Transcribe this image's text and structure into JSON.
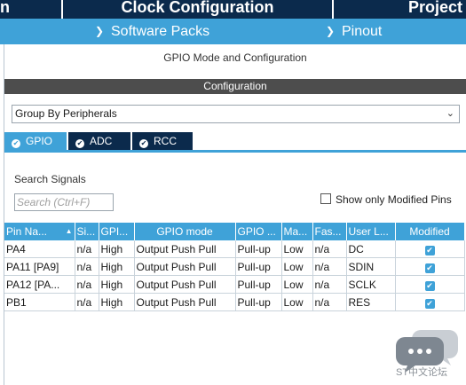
{
  "top_tabs": [
    "n",
    "Clock Configuration",
    "Project"
  ],
  "sub_menu": [
    "Software Packs",
    "Pinout"
  ],
  "section_title": "GPIO Mode and Configuration",
  "config_header": "Configuration",
  "group_select": {
    "value": "Group By Peripherals"
  },
  "peripheral_tabs": [
    {
      "label": "GPIO",
      "active": true
    },
    {
      "label": "ADC",
      "active": false
    },
    {
      "label": "RCC",
      "active": false
    }
  ],
  "search": {
    "label": "Search Signals",
    "placeholder": "Search (Ctrl+F)"
  },
  "show_modified": {
    "label": "Show only Modified Pins",
    "checked": false
  },
  "table": {
    "columns": [
      "Pin Na...",
      "Si...",
      "GPI...",
      "GPIO mode",
      "GPIO ...",
      "Ma...",
      "Fas...",
      "User L...",
      "Modified"
    ],
    "rows": [
      [
        "PA4",
        "n/a",
        "High",
        "Output Push Pull",
        "Pull-up",
        "Low",
        "n/a",
        "DC",
        "✔"
      ],
      [
        "PA11 [PA9]",
        "n/a",
        "High",
        "Output Push Pull",
        "Pull-up",
        "Low",
        "n/a",
        "SDIN",
        "✔"
      ],
      [
        "PA12 [PA...",
        "n/a",
        "High",
        "Output Push Pull",
        "Pull-up",
        "Low",
        "n/a",
        "SCLK",
        "✔"
      ],
      [
        "PB1",
        "n/a",
        "High",
        "Output Push Pull",
        "Pull-up",
        "Low",
        "n/a",
        "RES",
        "✔"
      ]
    ]
  },
  "watermark": {
    "text": "ST中文论坛",
    "icon": "chat-bubbles-icon"
  },
  "colors": {
    "navy": "#0b2a4c",
    "accent": "#3fa2d8",
    "header_dark": "#4d4d4d"
  }
}
